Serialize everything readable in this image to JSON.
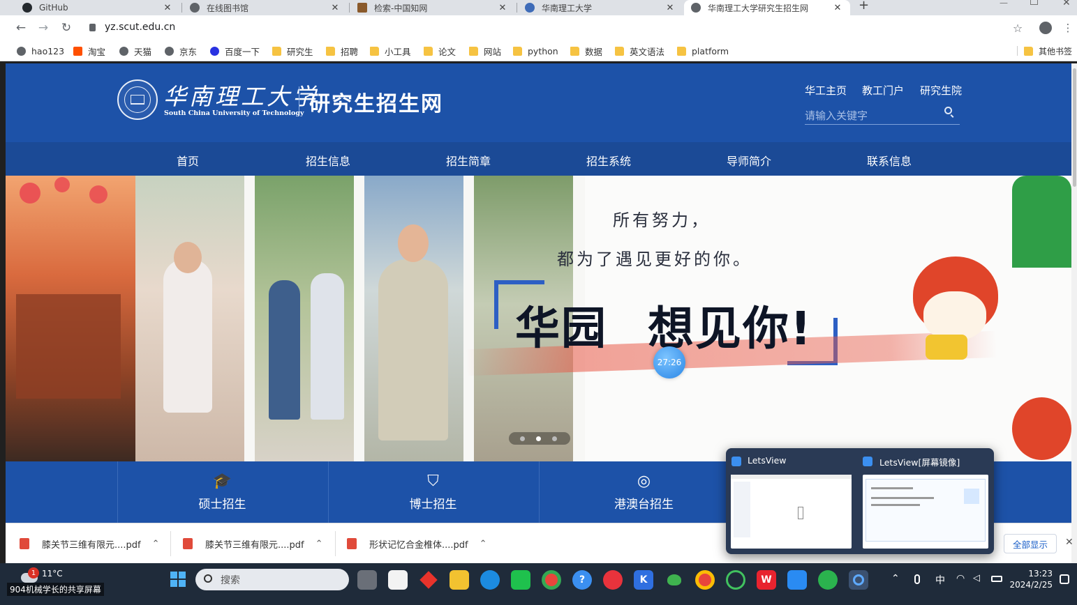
{
  "browser": {
    "tabs": [
      {
        "label": "GitHub"
      },
      {
        "label": "在线图书馆"
      },
      {
        "label": "检索-中国知网"
      },
      {
        "label": "华南理工大学"
      },
      {
        "label": "华南理工大学研究生招生网",
        "active": true
      }
    ],
    "new_tab": "+",
    "close_glyph": "✕",
    "url": "yz.scut.edu.cn",
    "bookmarks": [
      {
        "label": "hao123",
        "icon": "globe"
      },
      {
        "label": "淘宝",
        "icon": "taobao"
      },
      {
        "label": "天猫",
        "icon": "globe"
      },
      {
        "label": "京东",
        "icon": "globe"
      },
      {
        "label": "百度一下",
        "icon": "baidu"
      },
      {
        "label": "研究生",
        "icon": "folder"
      },
      {
        "label": "招聘",
        "icon": "folder"
      },
      {
        "label": "小工具",
        "icon": "folder"
      },
      {
        "label": "论文",
        "icon": "folder"
      },
      {
        "label": "网站",
        "icon": "folder"
      },
      {
        "label": "python",
        "icon": "folder"
      },
      {
        "label": "数据",
        "icon": "folder"
      },
      {
        "label": "英文语法",
        "icon": "folder"
      },
      {
        "label": "platform",
        "icon": "folder"
      }
    ],
    "other_bookmarks": "其他书签"
  },
  "site": {
    "logo_cn": "华南理工大学",
    "logo_en": "South China University of Technology",
    "site_title": "研究生招生网",
    "top_links": [
      "华工主页",
      "教工门户",
      "研究生院"
    ],
    "search_placeholder": "请输入关键字",
    "nav": [
      "首页",
      "招生信息",
      "招生简章",
      "招生系统",
      "导师简介",
      "联系信息"
    ],
    "banner": {
      "line1": "所有努力，",
      "line2": "都为了遇见更好的你。",
      "big_a": "华园",
      "big_b": "想见你!",
      "timer": "27:26"
    },
    "quick_links": [
      {
        "label": "硕士招生",
        "icon": "graduation-cap-icon"
      },
      {
        "label": "博士招生",
        "icon": "doctor-icon"
      },
      {
        "label": "港澳台招生",
        "icon": "globe-icon"
      }
    ]
  },
  "downloads": [
    {
      "label": "膝关节三维有限元....pdf"
    },
    {
      "label": "膝关节三维有限元....pdf"
    },
    {
      "label": "形状记忆合金椎体....pdf"
    }
  ],
  "downloads_show_all": "全部显示",
  "popup": {
    "items": [
      {
        "label": "LetsView"
      },
      {
        "label": "LetsView[屏幕镜像]"
      }
    ]
  },
  "taskbar": {
    "weather_temp": "11°C",
    "weather_badge": "1",
    "caption": "904机械学长的共享屏幕",
    "search_placeholder": "搜索",
    "ime": "中",
    "time": "13:23",
    "date": "2024/2/25"
  }
}
